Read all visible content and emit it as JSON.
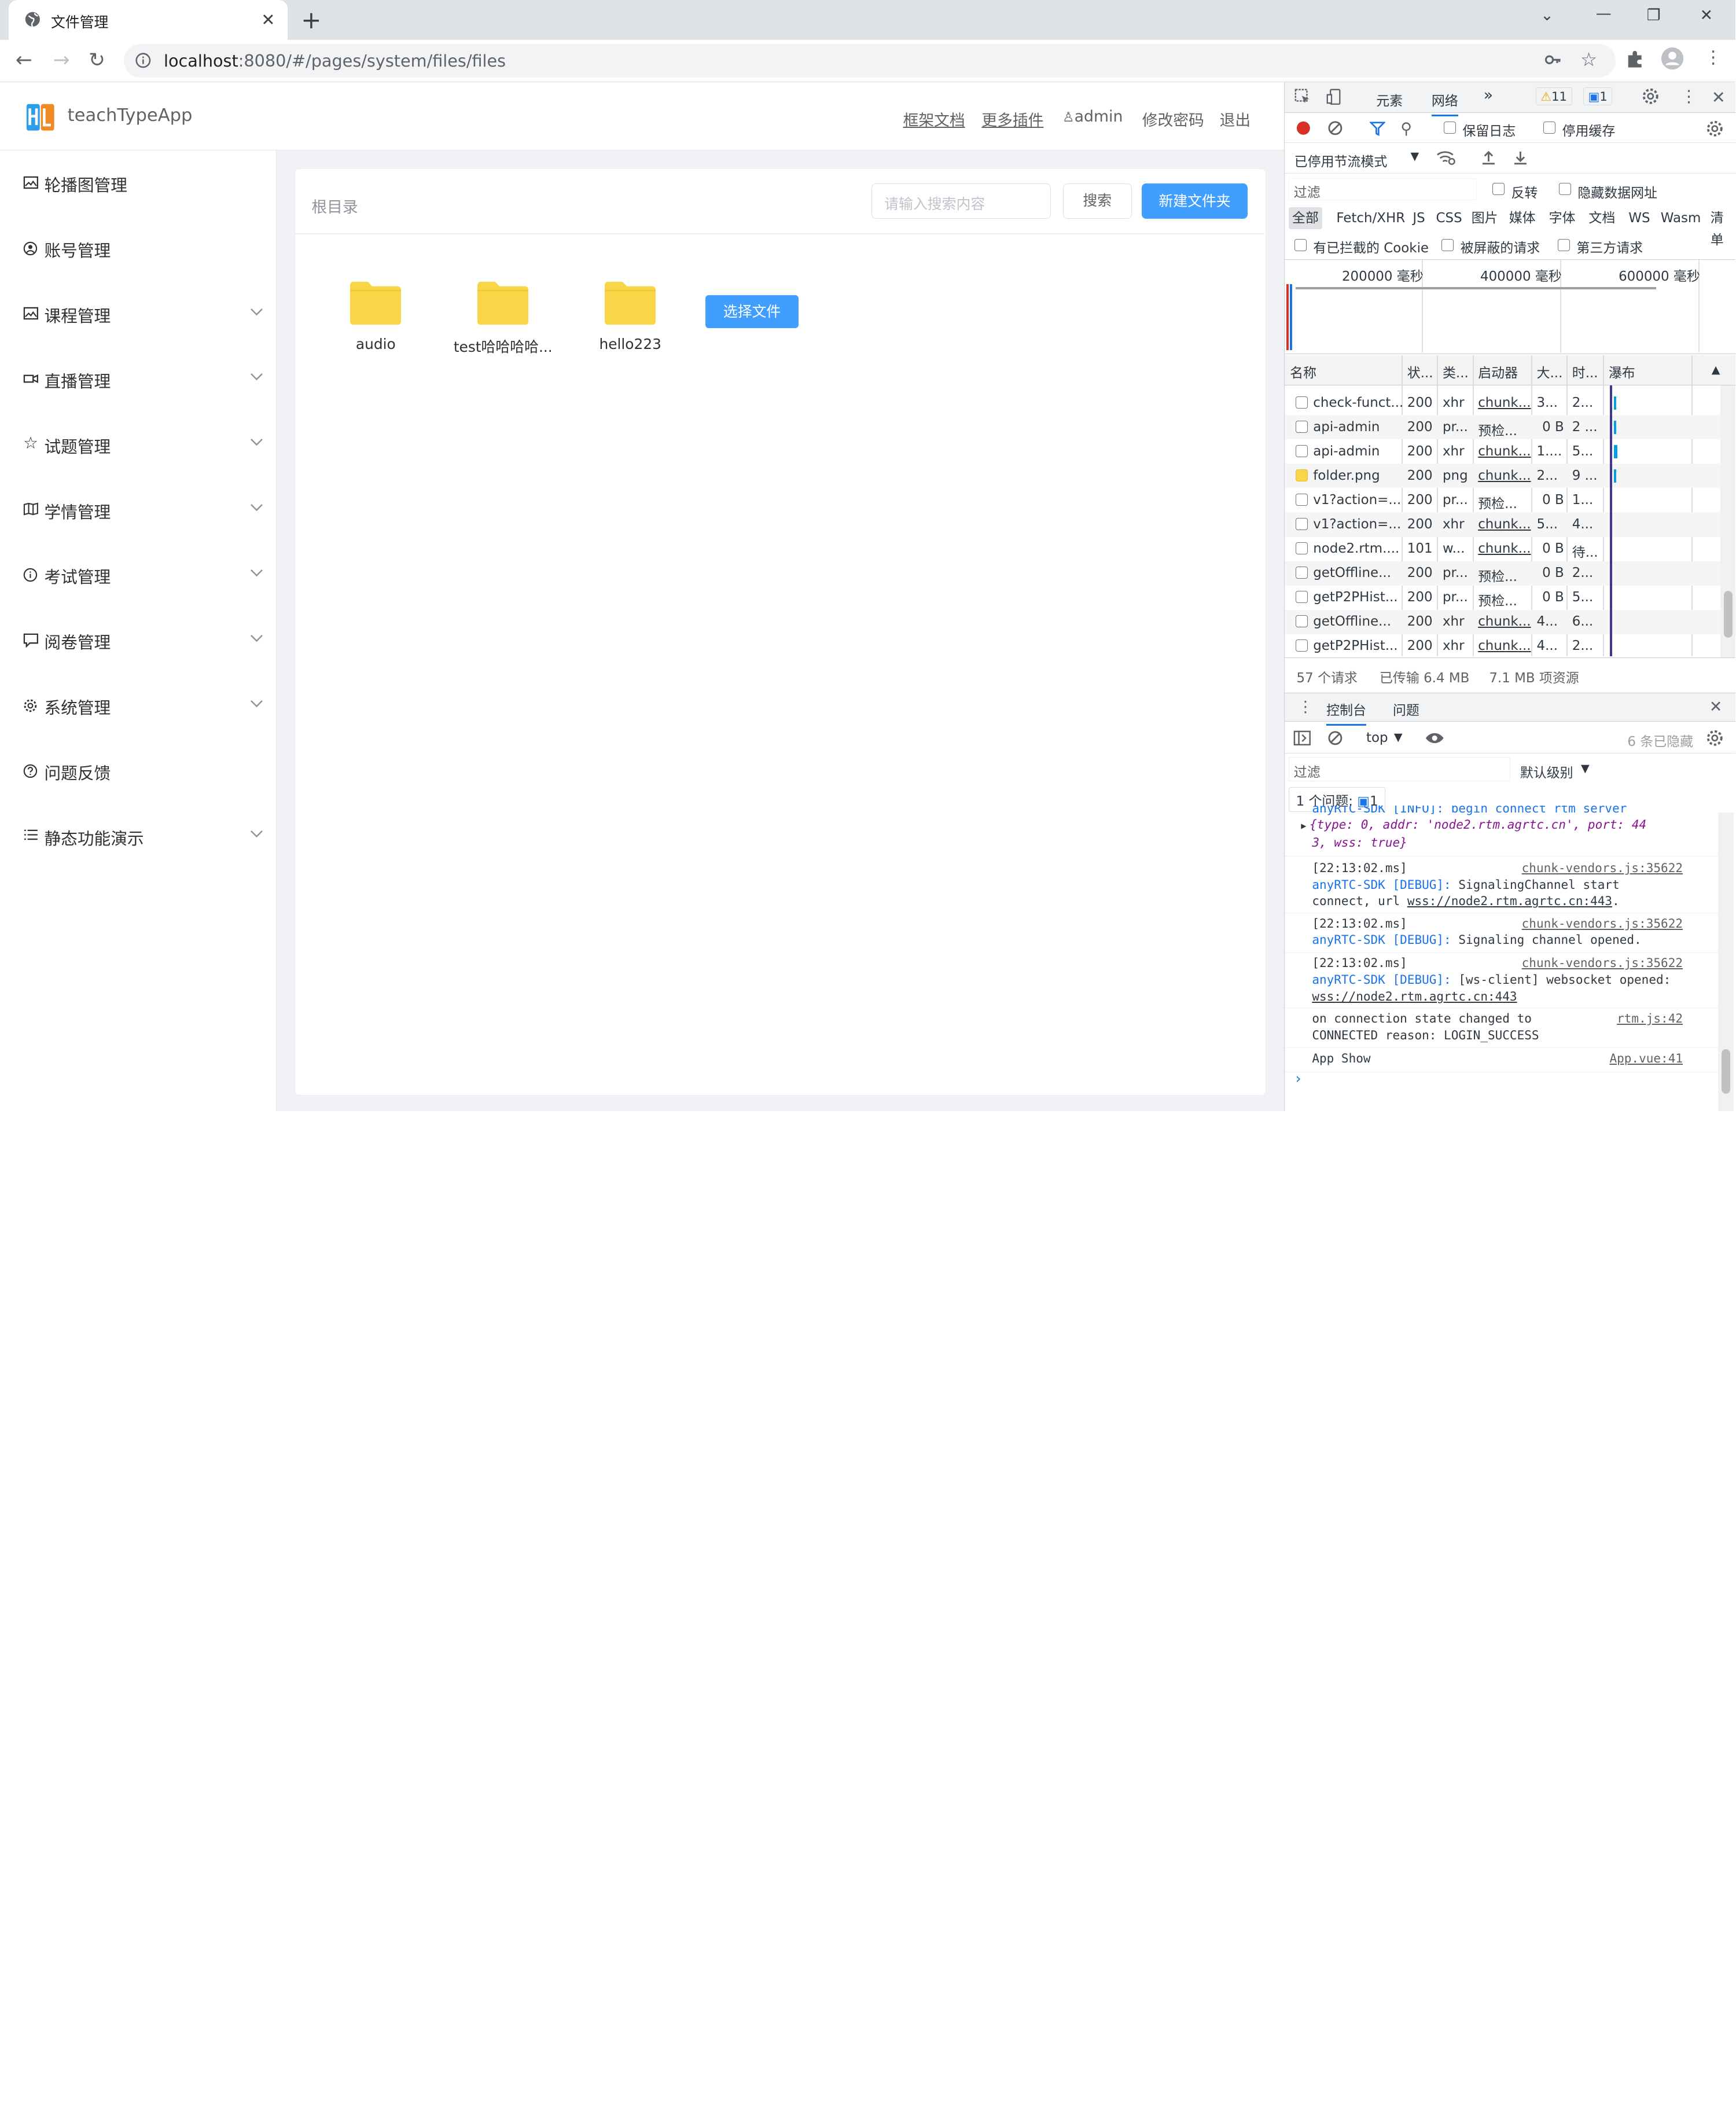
{
  "browser": {
    "tab_title": "文件管理",
    "url_host": "localhost",
    "url_path": ":8080/#/pages/system/files/files"
  },
  "app": {
    "name": "teachTypeApp",
    "nav": {
      "docs": "框架文档",
      "plugins": "更多插件",
      "user": "admin",
      "change_password": "修改密码",
      "logout": "退出"
    },
    "menu": [
      {
        "label": "轮播图管理",
        "icon": "picture-icon",
        "expandable": false
      },
      {
        "label": "账号管理",
        "icon": "user-icon",
        "expandable": false
      },
      {
        "label": "课程管理",
        "icon": "picture-icon",
        "expandable": true
      },
      {
        "label": "直播管理",
        "icon": "video-icon",
        "expandable": true
      },
      {
        "label": "试题管理",
        "icon": "star-icon",
        "expandable": true
      },
      {
        "label": "学情管理",
        "icon": "book-icon",
        "expandable": true
      },
      {
        "label": "考试管理",
        "icon": "info-icon",
        "expandable": true
      },
      {
        "label": "阅卷管理",
        "icon": "chat-icon",
        "expandable": true
      },
      {
        "label": "系统管理",
        "icon": "gear-icon",
        "expandable": true
      },
      {
        "label": "问题反馈",
        "icon": "question-icon",
        "expandable": false
      },
      {
        "label": "静态功能演示",
        "icon": "list-icon",
        "expandable": true
      }
    ],
    "breadcrumb": "根目录",
    "search_placeholder": "请输入搜索内容",
    "search_button": "搜索",
    "new_folder_button": "新建文件夹",
    "folders": [
      "audio",
      "test哈哈哈哈...",
      "hello223"
    ],
    "pick_file_button": "选择文件",
    "colors": {
      "primary": "#409eff",
      "folder": "#f8d648"
    }
  },
  "devtools": {
    "tabs": {
      "elements": "元素",
      "network": "网络"
    },
    "warnings": "11",
    "messages": "1",
    "network_toolbar": {
      "preserve_log": "保留日志",
      "disable_cache": "停用缓存",
      "throttle": "已停用节流模式",
      "filter_placeholder": "过滤",
      "invert": "反转",
      "hide_data_urls": "隐藏数据网址",
      "blocked_cookies": "有已拦截的 Cookie",
      "blocked_requests": "被屏蔽的请求",
      "third_party": "第三方请求"
    },
    "type_filters": [
      "全部",
      "Fetch/XHR",
      "JS",
      "CSS",
      "图片",
      "媒体",
      "字体",
      "文档",
      "WS",
      "Wasm",
      "清单"
    ],
    "timeline_ticks": [
      "200000 毫秒",
      "400000 毫秒",
      "600000 毫秒"
    ],
    "columns": [
      "名称",
      "状...",
      "类...",
      "启动器",
      "大...",
      "时...",
      "瀑布"
    ],
    "requests": [
      {
        "name": "check-funct...",
        "status": "200",
        "type": "xhr",
        "initiator": "chunk...",
        "size": "3...",
        "time": "2..."
      },
      {
        "name": "api-admin",
        "status": "200",
        "type": "pr...",
        "initiator": "预检...",
        "size": "0 B",
        "time": "2 ..."
      },
      {
        "name": "api-admin",
        "status": "200",
        "type": "xhr",
        "initiator": "chunk...",
        "size": "1....",
        "time": "5..."
      },
      {
        "name": "folder.png",
        "status": "200",
        "type": "png",
        "initiator": "chunk...",
        "size": "2...",
        "time": "9 ..."
      },
      {
        "name": "v1?action=...",
        "status": "200",
        "type": "pr...",
        "initiator": "预检...",
        "size": "0 B",
        "time": "1..."
      },
      {
        "name": "v1?action=...",
        "status": "200",
        "type": "xhr",
        "initiator": "chunk...",
        "size": "5...",
        "time": "4..."
      },
      {
        "name": "node2.rtm....",
        "status": "101",
        "type": "w...",
        "initiator": "chunk...",
        "size": "0 B",
        "time": "待..."
      },
      {
        "name": "getOffline...",
        "status": "200",
        "type": "pr...",
        "initiator": "预检...",
        "size": "0 B",
        "time": "2..."
      },
      {
        "name": "getP2PHist...",
        "status": "200",
        "type": "pr...",
        "initiator": "预检...",
        "size": "0 B",
        "time": "5..."
      },
      {
        "name": "getOffline...",
        "status": "200",
        "type": "xhr",
        "initiator": "chunk...",
        "size": "4...",
        "time": "6..."
      },
      {
        "name": "getP2PHist...",
        "status": "200",
        "type": "xhr",
        "initiator": "chunk...",
        "size": "4...",
        "time": "2..."
      }
    ],
    "summary": {
      "requests": "57 个请求",
      "transferred": "已传输 6.4 MB",
      "resources": "7.1 MB 项资源"
    },
    "drawer_tabs": {
      "console": "控制台",
      "issues": "问题"
    },
    "console_toolbar": {
      "context": "top",
      "hidden": "6 条已隐藏",
      "filter_placeholder": "过滤",
      "level": "默认级别",
      "issues_count": "1 个问题:",
      "issues_badge": "1"
    },
    "console": {
      "partial_top": "anyRTC-SDK [INFO]: begin connect rtm server",
      "obj_line1": "{type: 0, addr: 'node2.rtm.agrtc.cn', port: 44",
      "obj_line2": "3, wss: true}",
      "m1_time": "[22:13:02.ms]",
      "m1_src": "chunk-vendors.js:35622",
      "m1_sdk": "anyRTC-SDK [DEBUG]:",
      "m1_text": "SignalingChannel start",
      "m1_text2": "connect, url",
      "m1_url": "wss://node2.rtm.agrtc.cn:443",
      "m2_time": "[22:13:02.ms]",
      "m2_src": "chunk-vendors.js:35622",
      "m2_sdk": "anyRTC-SDK [DEBUG]:",
      "m2_text": "Signaling channel opened.",
      "m3_time": "[22:13:02.ms]",
      "m3_src": "chunk-vendors.js:35622",
      "m3_sdk": "anyRTC-SDK [DEBUG]:",
      "m3_text": "[ws-client] websocket opened:",
      "m3_url": "wss://node2.rtm.agrtc.cn:443",
      "m4_text": "on connection state changed to",
      "m4_text2": "CONNECTED reason: LOGIN_SUCCESS",
      "m4_src": "rtm.js:42",
      "m5_text": "App Show",
      "m5_src": "App.vue:41"
    }
  }
}
